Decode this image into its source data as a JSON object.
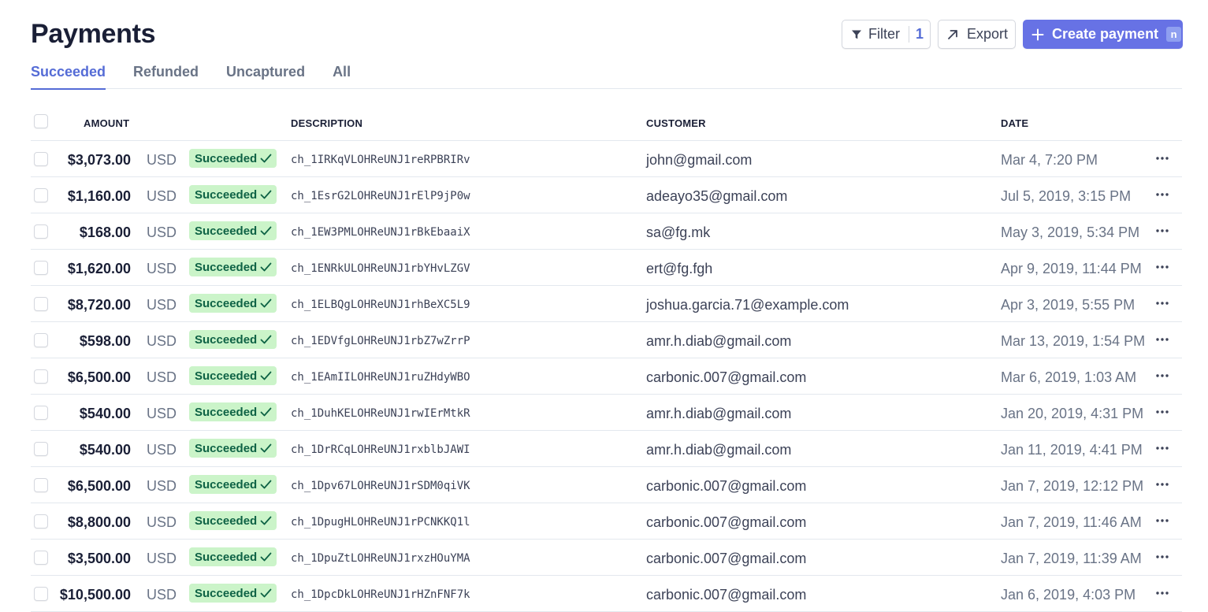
{
  "header": {
    "title": "Payments",
    "filter_label": "Filter",
    "filter_count": "1",
    "export_label": "Export",
    "create_label": "Create payment",
    "create_shortcut": "n"
  },
  "tabs": [
    {
      "label": "Succeeded"
    },
    {
      "label": "Refunded"
    },
    {
      "label": "Uncaptured"
    },
    {
      "label": "All"
    }
  ],
  "columns": {
    "amount": "AMOUNT",
    "description": "DESCRIPTION",
    "customer": "CUSTOMER",
    "date": "DATE"
  },
  "rows": [
    {
      "amount": "$3,073.00",
      "currency": "USD",
      "status": "Succeeded",
      "description": "ch_1IRKqVLOHReUNJ1reRPBRIRv",
      "customer": "john@gmail.com",
      "date": "Mar 4, 7:20 PM"
    },
    {
      "amount": "$1,160.00",
      "currency": "USD",
      "status": "Succeeded",
      "description": "ch_1EsrG2LOHReUNJ1rElP9jP0w",
      "customer": "adeayo35@gmail.com",
      "date": "Jul 5, 2019, 3:15 PM"
    },
    {
      "amount": "$168.00",
      "currency": "USD",
      "status": "Succeeded",
      "description": "ch_1EW3PMLOHReUNJ1rBkEbaaiX",
      "customer": "sa@fg.mk",
      "date": "May 3, 2019, 5:34 PM"
    },
    {
      "amount": "$1,620.00",
      "currency": "USD",
      "status": "Succeeded",
      "description": "ch_1ENRkULOHReUNJ1rbYHvLZGV",
      "customer": "ert@fg.fgh",
      "date": "Apr 9, 2019, 11:44 PM"
    },
    {
      "amount": "$8,720.00",
      "currency": "USD",
      "status": "Succeeded",
      "description": "ch_1ELBQgLOHReUNJ1rhBeXC5L9",
      "customer": "joshua.garcia.71@example.com",
      "date": "Apr 3, 2019, 5:55 PM"
    },
    {
      "amount": "$598.00",
      "currency": "USD",
      "status": "Succeeded",
      "description": "ch_1EDVfgLOHReUNJ1rbZ7wZrrP",
      "customer": "amr.h.diab@gmail.com",
      "date": "Mar 13, 2019, 1:54 PM"
    },
    {
      "amount": "$6,500.00",
      "currency": "USD",
      "status": "Succeeded",
      "description": "ch_1EAmIILOHReUNJ1ruZHdyWBO",
      "customer": "carbonic.007@gmail.com",
      "date": "Mar 6, 2019, 1:03 AM"
    },
    {
      "amount": "$540.00",
      "currency": "USD",
      "status": "Succeeded",
      "description": "ch_1DuhKELOHReUNJ1rwIErMtkR",
      "customer": "amr.h.diab@gmail.com",
      "date": "Jan 20, 2019, 4:31 PM"
    },
    {
      "amount": "$540.00",
      "currency": "USD",
      "status": "Succeeded",
      "description": "ch_1DrRCqLOHReUNJ1rxblbJAWI",
      "customer": "amr.h.diab@gmail.com",
      "date": "Jan 11, 2019, 4:41 PM"
    },
    {
      "amount": "$6,500.00",
      "currency": "USD",
      "status": "Succeeded",
      "description": "ch_1Dpv67LOHReUNJ1rSDM0qiVK",
      "customer": "carbonic.007@gmail.com",
      "date": "Jan 7, 2019, 12:12 PM"
    },
    {
      "amount": "$8,800.00",
      "currency": "USD",
      "status": "Succeeded",
      "description": "ch_1DpugHLOHReUNJ1rPCNKKQ1l",
      "customer": "carbonic.007@gmail.com",
      "date": "Jan 7, 2019, 11:46 AM"
    },
    {
      "amount": "$3,500.00",
      "currency": "USD",
      "status": "Succeeded",
      "description": "ch_1DpuZtLOHReUNJ1rxzHOuYMA",
      "customer": "carbonic.007@gmail.com",
      "date": "Jan 7, 2019, 11:39 AM"
    },
    {
      "amount": "$10,500.00",
      "currency": "USD",
      "status": "Succeeded",
      "description": "ch_1DpcDkLOHReUNJ1rHZnFNF7k",
      "customer": "carbonic.007@gmail.com",
      "date": "Jan 6, 2019, 4:03 PM"
    }
  ]
}
